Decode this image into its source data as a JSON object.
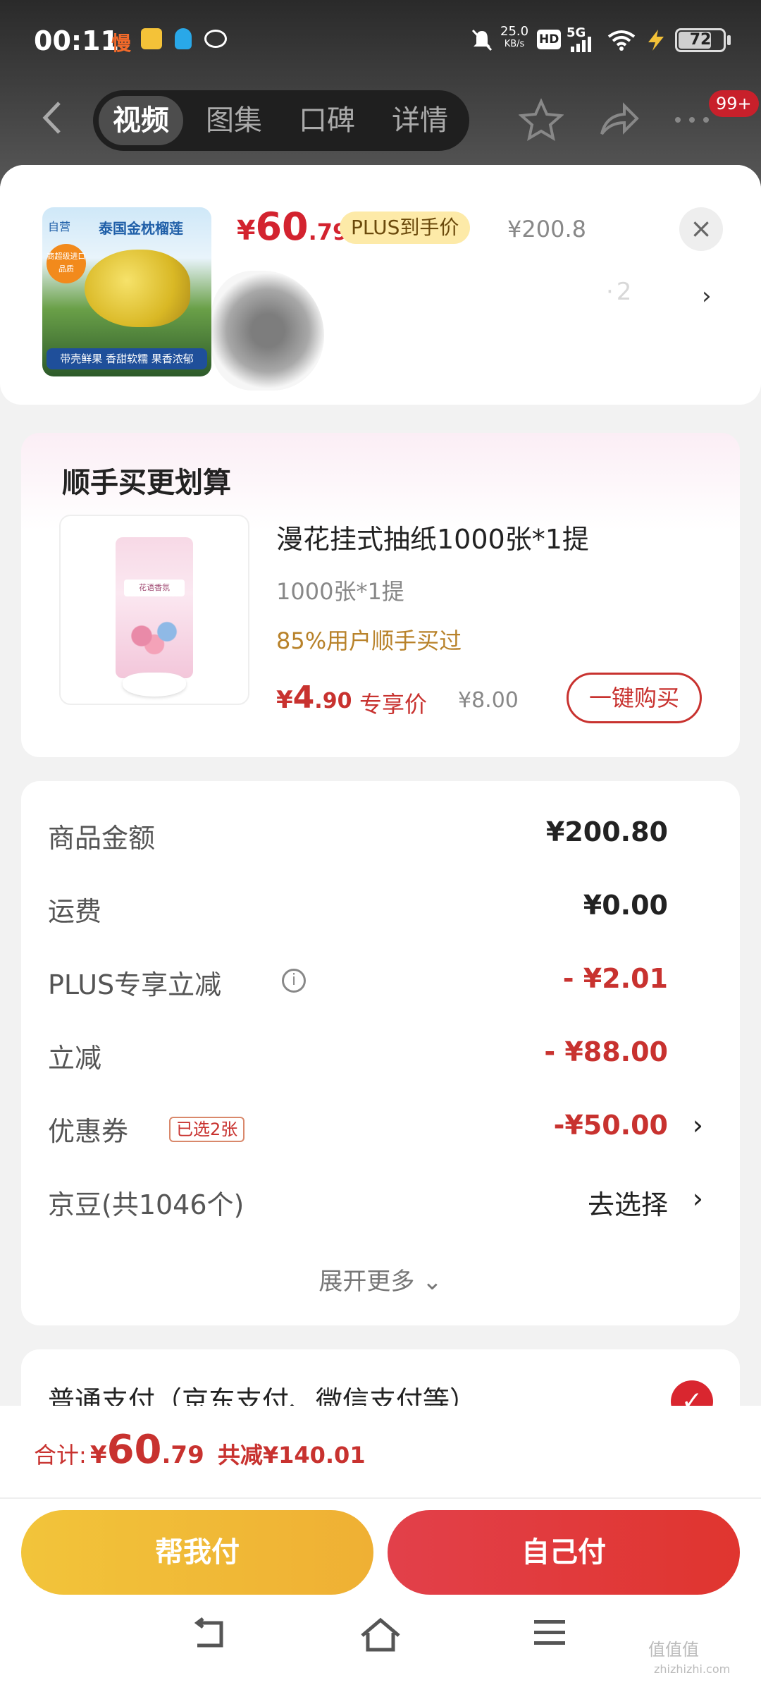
{
  "status_bar": {
    "time": "00:11",
    "net_speed": "25.0",
    "net_unit": "KB/s",
    "hd": "HD",
    "signal": "5G",
    "battery": "72",
    "app_icon_text": "慢"
  },
  "nav": {
    "tabs": [
      {
        "label": "视频",
        "active": true
      },
      {
        "label": "图集",
        "active": false
      },
      {
        "label": "口碑",
        "active": false
      },
      {
        "label": "详情",
        "active": false
      }
    ],
    "badge": "99+"
  },
  "product": {
    "thumb_title": "泰国金枕榴莲",
    "thumb_brand": "自营",
    "thumb_tag": "商超级进口品质",
    "thumb_bottom": "带壳鲜果 香甜软糯 果香浓郁",
    "price_symbol": "¥",
    "price_int": "60",
    "price_dec": ".79",
    "plus_tag": "PLUS到手价",
    "orig_price": "¥200.8",
    "name_obscured": "·2"
  },
  "bundle": {
    "title": "顺手买更划算",
    "name": "漫花挂式抽纸1000张*1提",
    "spec": "1000张*1提",
    "stat": "85%用户顺手买过",
    "price_symbol": "¥",
    "price_int": "4",
    "price_dec": ".90",
    "exclusive": "专享价",
    "orig_price": "¥8.00",
    "buy_label": "一键购买",
    "tissue_label": "花语香氛"
  },
  "summary": {
    "rows": [
      {
        "label": "商品金额",
        "value": "¥200.80"
      },
      {
        "label": "运费",
        "value": "¥0.00"
      },
      {
        "label": "PLUS专享立减",
        "value": "- ¥2.01"
      },
      {
        "label": "立减",
        "value": "- ¥88.00"
      },
      {
        "label": "优惠券",
        "chip": "已选2张",
        "value": "-¥50.00"
      },
      {
        "label": "京豆(共1046个)",
        "value": "去选择"
      }
    ],
    "expand": "展开更多"
  },
  "payment": {
    "label": "普通支付（京东支付、微信支付等）"
  },
  "bottom": {
    "total_label": "合计:",
    "total_symbol": "¥",
    "total_int": "60",
    "total_dec": ".79",
    "saved": "共减¥140.01",
    "help_pay": "帮我付",
    "self_pay": "自己付"
  },
  "watermark": {
    "text": "值值值",
    "domain": "zhizhizhi.com"
  },
  "colors": {
    "accent_red": "#c8322f",
    "gold": "#efb034",
    "plus_bg": "#fdeaa8"
  },
  "icons": [
    "back-icon",
    "star-icon",
    "share-icon",
    "more-icon",
    "close-icon",
    "chevron-right-icon",
    "info-icon",
    "check-icon",
    "nav-back-icon",
    "nav-home-icon",
    "nav-menu-icon"
  ]
}
